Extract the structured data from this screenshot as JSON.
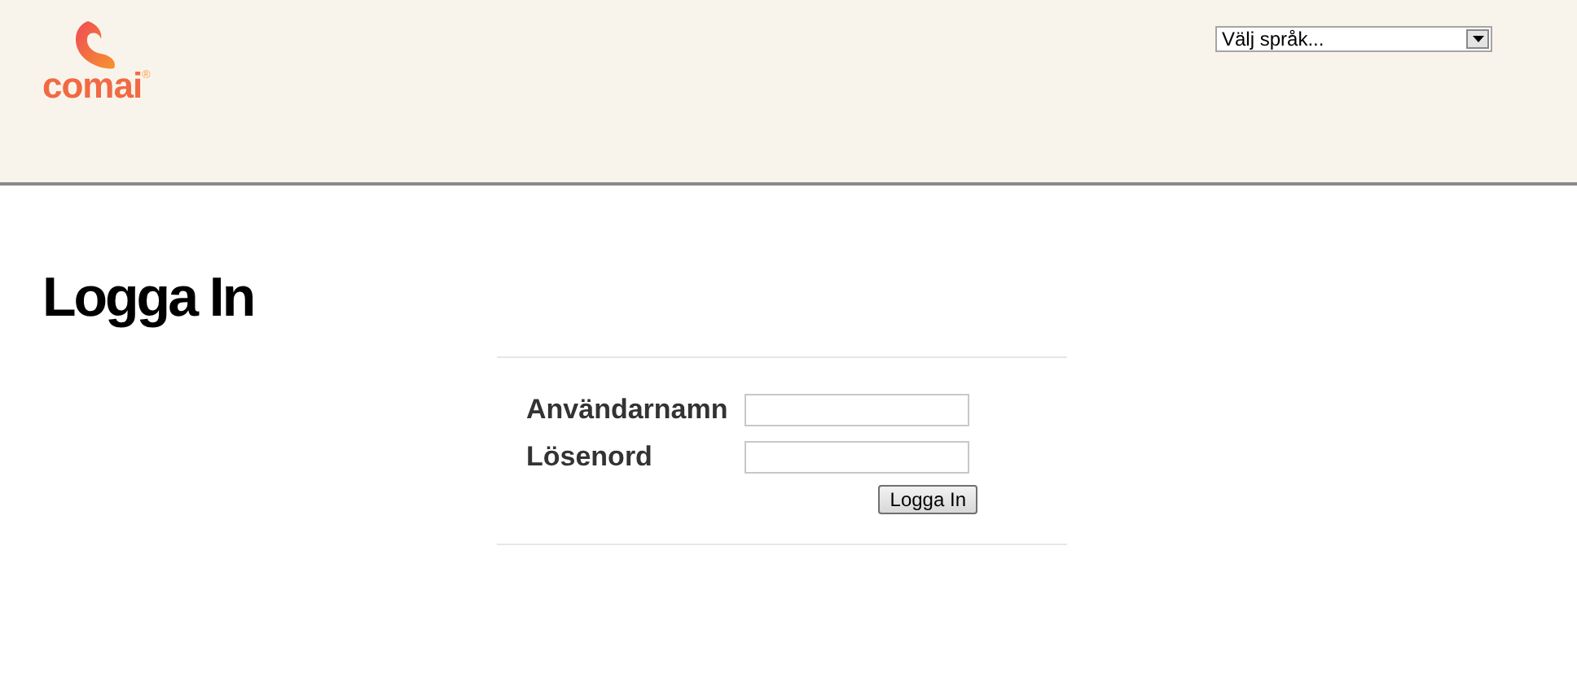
{
  "header": {
    "logo": {
      "text": "comai",
      "mark": "®"
    },
    "language_select": {
      "value": "Välj språk..."
    }
  },
  "page_title": "Logga In",
  "form": {
    "fields": [
      {
        "label": "Användarnamn"
      },
      {
        "label": "Lösenord"
      }
    ],
    "submit_button": "Logga In"
  }
}
